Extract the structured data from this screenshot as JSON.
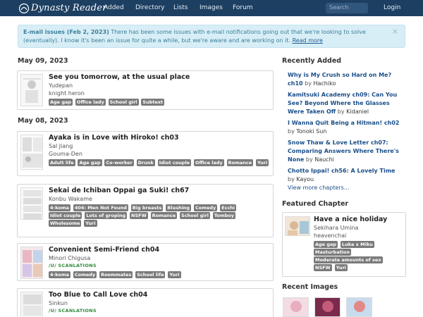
{
  "nav": {
    "brand": "Dynasty Reader",
    "links": [
      "Added",
      "Directory",
      "Lists",
      "Images",
      "Forum"
    ],
    "search_placeholder": "Search",
    "login": "Login"
  },
  "alert": {
    "title": "E-mail issues (Feb 2, 2023)",
    "text": "There has been some issues with e-mail notifications going out that we're looking to solve (eventually). I know it's been an issue for quite a while, but we're aware and are working on it.",
    "link": "Read more",
    "close": "×"
  },
  "dates": [
    "May 09, 2023",
    "May 08, 2023"
  ],
  "releases": [
    {
      "title": "See you tomorrow, at the usual place",
      "lines": [
        "Yudepan",
        "knight heron"
      ],
      "tags": [
        "Age gap",
        "Office lady",
        "School girl",
        "Subtext"
      ]
    },
    {
      "title": "Ayaka is in Love with Hiroko! ch03",
      "lines": [
        "Sal Jiang",
        "Gouma-Den"
      ],
      "tags": [
        "Adult life",
        "Age gap",
        "Co-worker",
        "Drunk",
        "Idiot couple",
        "Office lady",
        "Romance",
        "Yuri"
      ]
    },
    {
      "title": "Sekai de Ichiban Oppai ga Suki! ch67",
      "lines": [
        "Konbu Wakame"
      ],
      "tags": [
        "4-koma",
        "404: Men Not Found",
        "Big breasts",
        "Blushing",
        "Comedy",
        "Ecchi",
        "Idiot couple",
        "Lots of groping",
        "NSFW",
        "Romance",
        "School girl",
        "Tomboy",
        "Wholesome",
        "Yuri"
      ]
    },
    {
      "title": "Convenient Semi-Friend ch04",
      "lines": [
        "Minori Chigusa"
      ],
      "scanlator": "/U/ SCANLATIONS",
      "tags": [
        "4-koma",
        "Comedy",
        "Roommates",
        "School life",
        "Yuri"
      ]
    },
    {
      "title": "Too Blue to Call Love ch04",
      "lines": [
        "Sinkun"
      ],
      "scanlator": "/U/ SCANLATIONS",
      "tags": []
    }
  ],
  "sidebar": {
    "recent_heading": "Recently Added",
    "recent": [
      {
        "title": "Why is My Crush so Hard on Me? ch10",
        "by": "by",
        "author": "Hachiko"
      },
      {
        "title": "Kamitsuki Academy ch09: Can You See? Beyond Where the Glasses Were Taken Off",
        "by": "by",
        "author": "Kidaniel"
      },
      {
        "title": "I Wanna Quit Being a Hitman! ch02",
        "by": "by",
        "author": "Tonoki Sun"
      },
      {
        "title": "Snow Thaw & Love Letter ch07: Comparing Answers Where There's None",
        "by": "by",
        "author": "Nauchi"
      },
      {
        "title": "Chotto Ippai! ch56: A Lovely Time",
        "by": "by",
        "author": "Kayou"
      }
    ],
    "view_more": "View more chapters...",
    "featured_heading": "Featured Chapter",
    "featured": {
      "title": "Have a nice holiday",
      "lines": [
        "Sekihara Umina",
        "heavenchai"
      ],
      "tags": [
        "Age gap",
        "Luka x Miku",
        "Masturbation",
        "Moderate amounts of sex",
        "NSFW",
        "Yuri"
      ]
    },
    "images_heading": "Recent Images"
  },
  "colors": {
    "navbar": "#1d3f62",
    "link": "#1a4f8a",
    "tag": "#7a7a7a",
    "alert_bg": "#d8eef6"
  }
}
